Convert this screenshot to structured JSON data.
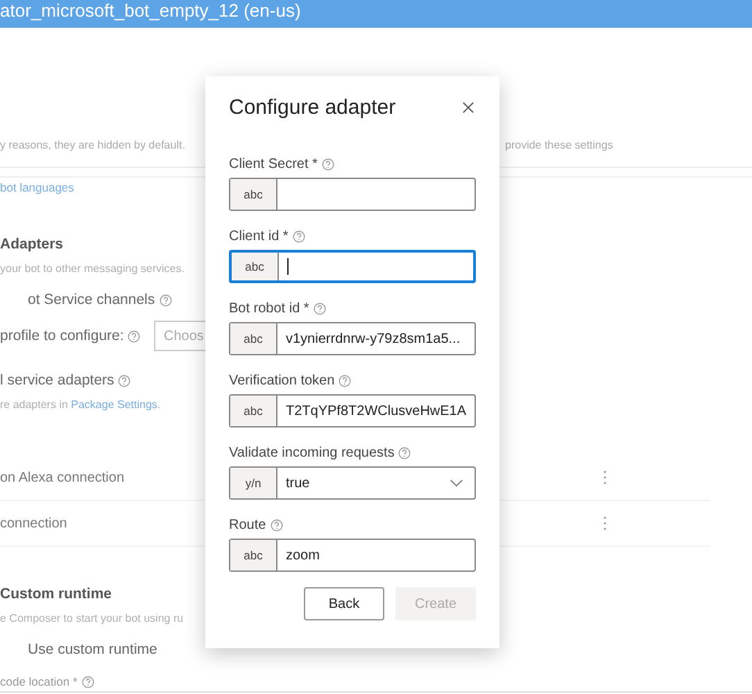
{
  "header": {
    "title": "ator_microsoft_bot_empty_12 (en-us)"
  },
  "notice": {
    "text": "y reasons, they are hidden by default.",
    "text_right": "provide these settings"
  },
  "sections": [
    {
      "kind": "link",
      "text": "bot languages"
    },
    {
      "kind": "heading",
      "text": "Adapters"
    },
    {
      "kind": "desc",
      "text": "your bot to other messaging services."
    },
    {
      "kind": "subheading",
      "text": "ot Service channels",
      "help": true
    },
    {
      "kind": "dropdown-row",
      "text": "profile to configure:",
      "help": true,
      "dropdown": "Choos"
    },
    {
      "kind": "subheading",
      "text": "l service adapters",
      "help": true
    },
    {
      "kind": "desc",
      "text": "re adapters in **Package Settings**."
    },
    {
      "kind": "connection",
      "text": "on Alexa connection",
      "menu": true
    },
    {
      "kind": "connection",
      "text": "connection",
      "menu": true
    },
    {
      "kind": "heading",
      "text": "Custom runtime"
    },
    {
      "kind": "desc",
      "text": "e Composer to start your bot using ru"
    },
    {
      "kind": "subheading",
      "text": "Use custom runtime"
    },
    {
      "kind": "label",
      "text": "code location *",
      "help": true
    }
  ],
  "dialog": {
    "title": "Configure adapter",
    "fields": [
      {
        "kind": "text",
        "label": "Client Secret *",
        "help": true,
        "prefix": "abc",
        "focused": false
      },
      {
        "kind": "text",
        "label": "Client id *",
        "help": true,
        "prefix": "abc",
        "focused": true
      },
      {
        "kind": "text",
        "label": "Bot robot id *",
        "help": true,
        "prefix": "abc",
        "value": "v1ynierrdnrw-y79z8sm1a5...",
        "focused": false
      },
      {
        "kind": "text",
        "label": "Verification token",
        "help": true,
        "prefix": "abc",
        "value": "T2TqYPf8T2WClusveHwE1A",
        "focused": false
      },
      {
        "kind": "select",
        "label": "Validate incoming requests",
        "help": true,
        "prefix": "y/n",
        "value": "true",
        "focused": false
      },
      {
        "kind": "text",
        "label": "Route",
        "help": true,
        "prefix": "abc",
        "value": "zoom",
        "focused": false
      }
    ],
    "buttons": [
      {
        "label": "Back",
        "disabled": false
      },
      {
        "label": "Create",
        "disabled": true
      }
    ]
  }
}
